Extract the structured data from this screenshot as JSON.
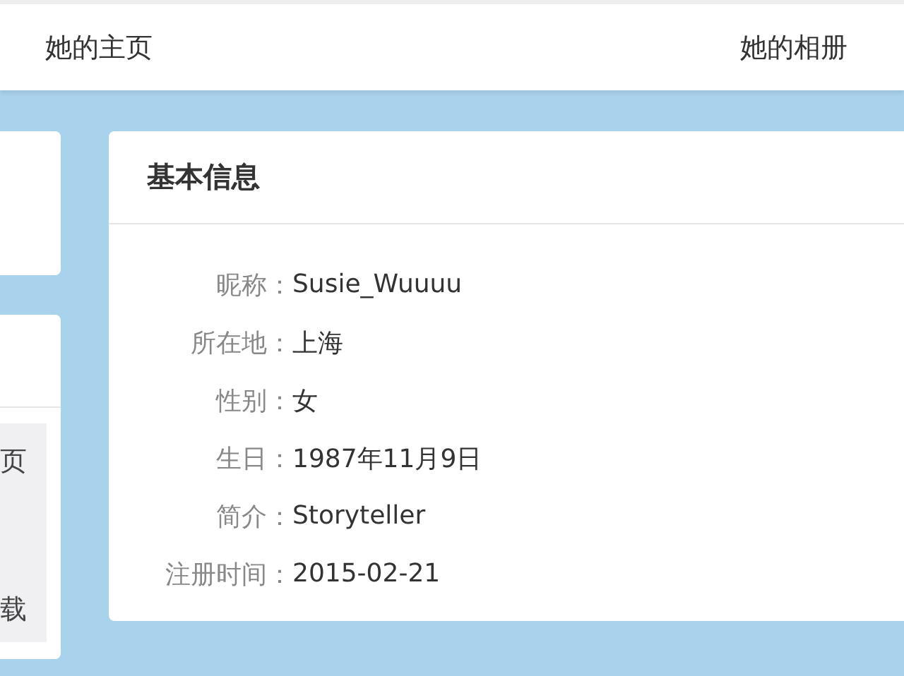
{
  "nav": {
    "items": [
      {
        "label": "她的主页"
      },
      {
        "label": "她的相册"
      }
    ]
  },
  "side_cards": {
    "menu_items": [
      {
        "label": "页"
      },
      {
        "label": "载"
      }
    ]
  },
  "info_card": {
    "title": "基本信息",
    "fields": [
      {
        "label": "昵称：",
        "value": "Susie_Wuuuu"
      },
      {
        "label": "所在地：",
        "value": "上海"
      },
      {
        "label": "性别：",
        "value": "女"
      },
      {
        "label": "生日：",
        "value": "1987年11月9日"
      },
      {
        "label": "简介：",
        "value": "Storyteller"
      },
      {
        "label": "注册时间：",
        "value": "2015-02-21"
      }
    ]
  }
}
